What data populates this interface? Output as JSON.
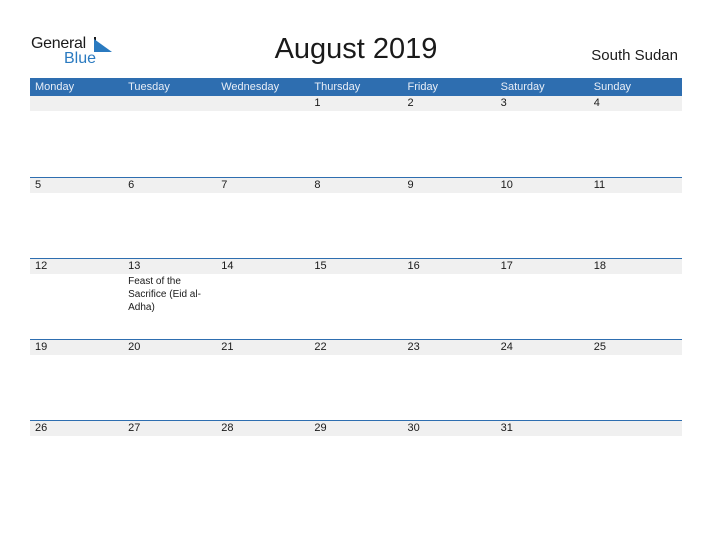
{
  "logo": {
    "line1": "General",
    "line2": "Blue"
  },
  "title": "August 2019",
  "country": "South Sudan",
  "weekdays": [
    "Monday",
    "Tuesday",
    "Wednesday",
    "Thursday",
    "Friday",
    "Saturday",
    "Sunday"
  ],
  "weeks": [
    {
      "days": [
        {
          "num": "",
          "event": ""
        },
        {
          "num": "",
          "event": ""
        },
        {
          "num": "",
          "event": ""
        },
        {
          "num": "1",
          "event": ""
        },
        {
          "num": "2",
          "event": ""
        },
        {
          "num": "3",
          "event": ""
        },
        {
          "num": "4",
          "event": ""
        }
      ]
    },
    {
      "days": [
        {
          "num": "5",
          "event": ""
        },
        {
          "num": "6",
          "event": ""
        },
        {
          "num": "7",
          "event": ""
        },
        {
          "num": "8",
          "event": ""
        },
        {
          "num": "9",
          "event": ""
        },
        {
          "num": "10",
          "event": ""
        },
        {
          "num": "11",
          "event": ""
        }
      ]
    },
    {
      "days": [
        {
          "num": "12",
          "event": ""
        },
        {
          "num": "13",
          "event": "Feast of the Sacrifice (Eid al-Adha)"
        },
        {
          "num": "14",
          "event": ""
        },
        {
          "num": "15",
          "event": ""
        },
        {
          "num": "16",
          "event": ""
        },
        {
          "num": "17",
          "event": ""
        },
        {
          "num": "18",
          "event": ""
        }
      ]
    },
    {
      "days": [
        {
          "num": "19",
          "event": ""
        },
        {
          "num": "20",
          "event": ""
        },
        {
          "num": "21",
          "event": ""
        },
        {
          "num": "22",
          "event": ""
        },
        {
          "num": "23",
          "event": ""
        },
        {
          "num": "24",
          "event": ""
        },
        {
          "num": "25",
          "event": ""
        }
      ]
    },
    {
      "days": [
        {
          "num": "26",
          "event": ""
        },
        {
          "num": "27",
          "event": ""
        },
        {
          "num": "28",
          "event": ""
        },
        {
          "num": "29",
          "event": ""
        },
        {
          "num": "30",
          "event": ""
        },
        {
          "num": "31",
          "event": ""
        },
        {
          "num": "",
          "event": ""
        }
      ]
    }
  ],
  "colors": {
    "accent": "#2e6eb0",
    "logo_blue": "#2a7ac0",
    "band": "#f0f0f0"
  }
}
